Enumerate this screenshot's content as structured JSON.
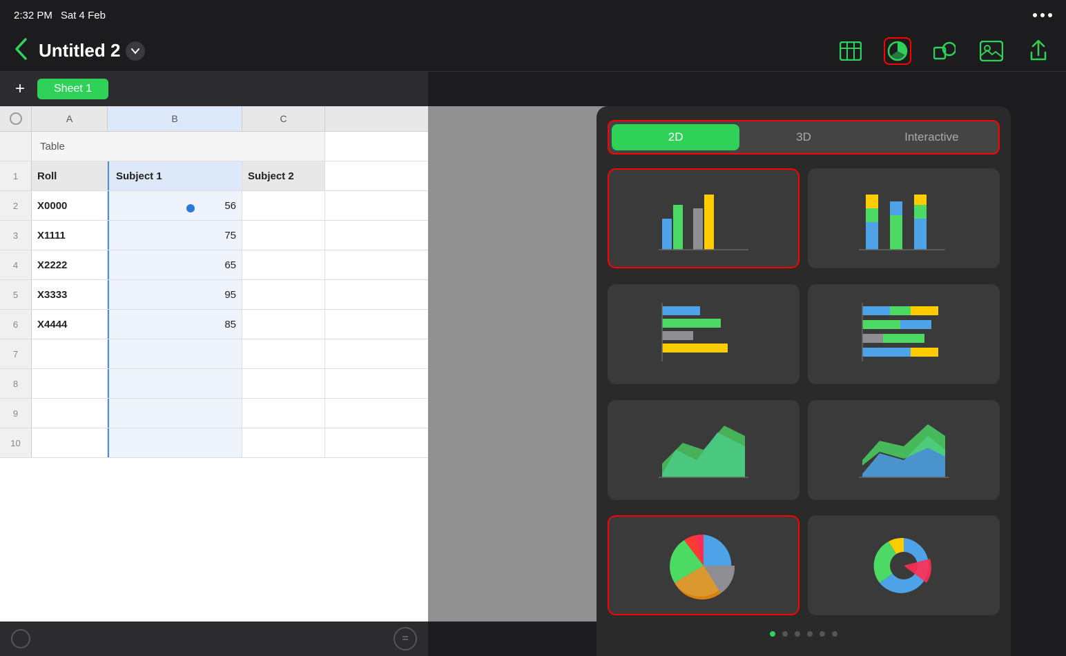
{
  "status_bar": {
    "time": "2:32 PM",
    "date": "Sat 4 Feb"
  },
  "title_bar": {
    "back_label": "‹",
    "doc_title": "Untitled 2",
    "chevron": "∨",
    "icons": {
      "table": "table-icon",
      "chart": "chart-icon",
      "shapes": "shapes-icon",
      "media": "media-icon",
      "share": "share-icon"
    }
  },
  "sheet_tab": {
    "add_label": "+",
    "tab_name": "Sheet 1"
  },
  "spreadsheet": {
    "col_headers": [
      "A",
      "B",
      "C"
    ],
    "table_title": "Table",
    "rows": [
      {
        "num": "1",
        "a": "Roll",
        "b": "Subject 1",
        "c": "Subject 2",
        "is_header": true
      },
      {
        "num": "2",
        "a": "X0000",
        "b": "56",
        "c": "",
        "is_header": false
      },
      {
        "num": "3",
        "a": "X1111",
        "b": "75",
        "c": "",
        "is_header": false
      },
      {
        "num": "4",
        "a": "X2222",
        "b": "65",
        "c": "",
        "is_header": false
      },
      {
        "num": "5",
        "a": "X3333",
        "b": "95",
        "c": "",
        "is_header": false
      },
      {
        "num": "6",
        "a": "X4444",
        "b": "85",
        "c": "",
        "is_header": false
      },
      {
        "num": "7",
        "a": "",
        "b": "",
        "c": "",
        "is_header": false
      },
      {
        "num": "8",
        "a": "",
        "b": "",
        "c": "",
        "is_header": false
      },
      {
        "num": "9",
        "a": "",
        "b": "",
        "c": "",
        "is_header": false
      },
      {
        "num": "10",
        "a": "",
        "b": "",
        "c": "",
        "is_header": false
      }
    ]
  },
  "chart_picker": {
    "tabs": [
      "2D",
      "3D",
      "Interactive"
    ],
    "active_tab": "2D",
    "chart_types": [
      {
        "id": "bar-grouped",
        "label": "Grouped Bar",
        "selected": true
      },
      {
        "id": "bar-stacked",
        "label": "Stacked Bar",
        "selected": false
      },
      {
        "id": "horizontal-bar",
        "label": "Horizontal Bar",
        "selected": false
      },
      {
        "id": "horizontal-stacked",
        "label": "Horizontal Stacked",
        "selected": false
      },
      {
        "id": "area",
        "label": "Area Chart",
        "selected": false
      },
      {
        "id": "area-stacked",
        "label": "Stacked Area",
        "selected": false
      },
      {
        "id": "pie",
        "label": "Pie Chart",
        "selected": true
      },
      {
        "id": "donut",
        "label": "Donut Chart",
        "selected": false
      }
    ],
    "pagination": {
      "total": 6,
      "active": 0
    }
  },
  "colors": {
    "green": "#30d158",
    "blue": "#4a90d9",
    "chart_blue": "#4ea3e8",
    "chart_green": "#4cd964",
    "chart_gray": "#8e8e93",
    "chart_yellow": "#ffcc00",
    "chart_orange": "#ff9500",
    "chart_red": "#ff3b30",
    "chart_pink": "#ff2d55",
    "bg_dark": "#2a2a2a",
    "red_border": "#ff0000"
  }
}
